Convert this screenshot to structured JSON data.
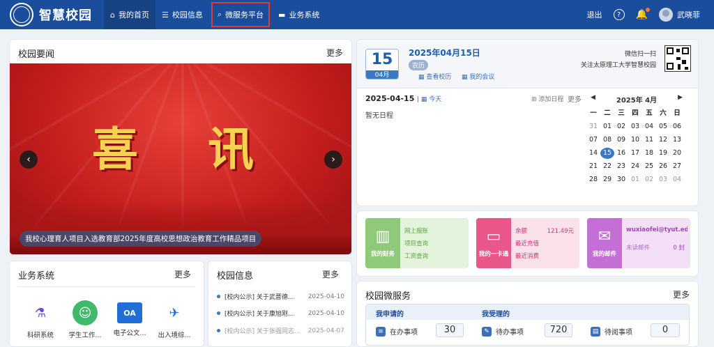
{
  "nav": {
    "brand": "智慧校园",
    "items": [
      {
        "label": "我的首页",
        "icon": "home-icon"
      },
      {
        "label": "校园信息",
        "icon": "list-icon"
      },
      {
        "label": "微服务平台",
        "icon": "service-icon"
      },
      {
        "label": "业务系统",
        "icon": "cart-icon"
      }
    ],
    "logout": "退出",
    "user": "武晓菲"
  },
  "news": {
    "title": "校园要闻",
    "more": "更多",
    "banner_text": [
      "喜",
      "讯"
    ],
    "caption": "我校心理育人项目入选教育部2025年度高校思想政治教育工作精品项目"
  },
  "calendar": {
    "day": "15",
    "month_tag": "04月",
    "full_date": "2025年04月15日",
    "lunar_tag": "农历",
    "link_view": "查看校历",
    "link_meeting": "我的会议",
    "qr_title": "微信扫一扫",
    "qr_subtitle": "关注太原理工大学智慧校园",
    "sched_date": "2025-04-15",
    "sched_today": "今天",
    "sched_add": "添加日程",
    "sched_more": "更多",
    "sched_empty": "暂无日程",
    "mini_title": "2025年 4月",
    "weekdays": [
      "一",
      "二",
      "三",
      "四",
      "五",
      "六",
      "日"
    ],
    "days": [
      [
        "31",
        "01",
        "02",
        "03",
        "04",
        "05",
        "06"
      ],
      [
        "07",
        "08",
        "09",
        "10",
        "11",
        "12",
        "13"
      ],
      [
        "14",
        "15",
        "16",
        "17",
        "18",
        "19",
        "20"
      ],
      [
        "21",
        "22",
        "23",
        "24",
        "25",
        "26",
        "27"
      ],
      [
        "28",
        "29",
        "30",
        "01",
        "02",
        "03",
        "04"
      ]
    ]
  },
  "cards": {
    "finance": {
      "label": "我的财务",
      "lines": [
        "网上报账",
        "项目查询",
        "工资查询"
      ]
    },
    "ecard": {
      "label": "我的一卡通",
      "balance_label": "余额",
      "balance": "121.49元",
      "recharge": "最近充值",
      "spend": "最近消费"
    },
    "mail": {
      "label": "我的邮件",
      "address": "wuxiaofei@tyut.edu.c",
      "unread_label": "未读邮件",
      "unread": "0 封"
    }
  },
  "micro": {
    "title": "校园微服务",
    "more": "更多",
    "my_apply": "我申请的",
    "my_accept": "我受理的",
    "in_progress": "在办事项",
    "in_progress_count": "30",
    "todo": "待办事项",
    "todo_count": "720",
    "toread": "待阅事项",
    "toread_count": "0"
  },
  "biz": {
    "title": "业务系统",
    "more": "更多",
    "items": [
      "科研系统",
      "学生工作...",
      "电子公文...",
      "出入境综..."
    ]
  },
  "info": {
    "title": "校园信息",
    "more": "更多",
    "rows": [
      {
        "title": "[校内公示] 关于武晋德...",
        "date": "2025-04-10"
      },
      {
        "title": "[校内公示] 关于康旭刚...",
        "date": "2025-04-10"
      },
      {
        "title": "[校内公示] 关于张强同志...",
        "date": "2025-04-07"
      }
    ]
  },
  "colors": {
    "brand": "#1a4d9c",
    "finance": "#8fc97a",
    "ecard": "#e8568a",
    "mail": "#c46fd6"
  }
}
